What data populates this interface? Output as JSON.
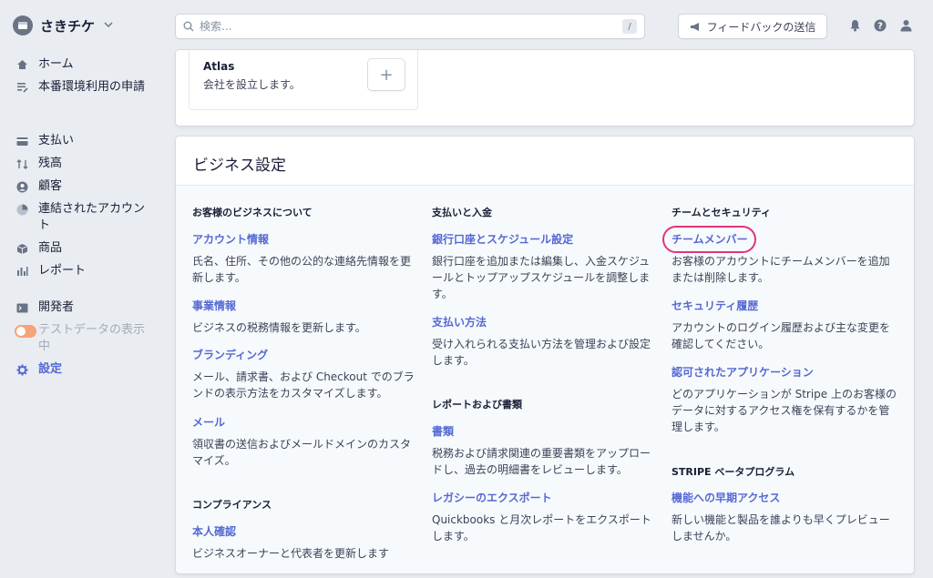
{
  "account": {
    "name": "さきチケ"
  },
  "nav": {
    "home": "ホーム",
    "activate": "本番環境利用の申請",
    "payments": "支払い",
    "balances": "残高",
    "customers": "顧客",
    "connected": "連結されたアカウント",
    "products": "商品",
    "reports": "レポート",
    "developers": "開発者",
    "test_data": "テストデータの表示中",
    "settings": "設定"
  },
  "search": {
    "placeholder": "検索...",
    "shortcut": "/"
  },
  "feedback": {
    "label": "フィードバックの送信"
  },
  "atlas": {
    "title": "Atlas",
    "description": "会社を設立します。",
    "add": "+"
  },
  "business_settings": {
    "title": "ビジネス設定",
    "col1": {
      "title": "お客様のビジネスについて",
      "items": [
        {
          "link": "アカウント情報",
          "desc": "氏名、住所、その他の公的な連絡先情報を更新します。"
        },
        {
          "link": "事業情報",
          "desc": "ビジネスの税務情報を更新します。"
        },
        {
          "link": "ブランディング",
          "desc": "メール、請求書、および Checkout でのブランドの表示方法をカスタマイズします。"
        },
        {
          "link": "メール",
          "desc": "領収書の送信およびメールドメインのカスタマイズ。"
        }
      ],
      "title2": "コンプライアンス",
      "items2": [
        {
          "link": "本人確認",
          "desc": "ビジネスオーナーと代表者を更新します"
        }
      ]
    },
    "col2": {
      "title": "支払いと入金",
      "items": [
        {
          "link": "銀行口座とスケジュール設定",
          "desc": "銀行口座を追加または編集し、入金スケジュールとトップアップスケジュールを調整します。"
        },
        {
          "link": "支払い方法",
          "desc": "受け入れられる支払い方法を管理および設定します。"
        }
      ],
      "title2": "レポートおよび書類",
      "items2": [
        {
          "link": "書類",
          "desc": "税務および請求関連の重要書類をアップロードし、過去の明細書をレビューします。"
        },
        {
          "link": "レガシーのエクスポート",
          "desc": "Quickbooks と月次レポートをエクスポートします。"
        }
      ]
    },
    "col3": {
      "title": "チームとセキュリティ",
      "items": [
        {
          "link": "チームメンバー",
          "desc": "お客様のアカウントにチームメンバーを追加または削除します。"
        },
        {
          "link": "セキュリティ履歴",
          "desc": "アカウントのログイン履歴および主な変更を確認してください。"
        },
        {
          "link": "認可されたアプリケーション",
          "desc": "どのアプリケーションが Stripe 上のお客様のデータに対するアクセス権を保有するかを管理します。"
        }
      ],
      "title2": "STRIPE ベータプログラム",
      "items2": [
        {
          "link": "機能への早期アクセス",
          "desc": "新しい機能と製品を誰よりも早くプレビューしませんか。"
        }
      ]
    }
  },
  "colors": {
    "accent": "#5469d4",
    "highlight": "#e4347a",
    "toggle": "#f5a37a"
  }
}
